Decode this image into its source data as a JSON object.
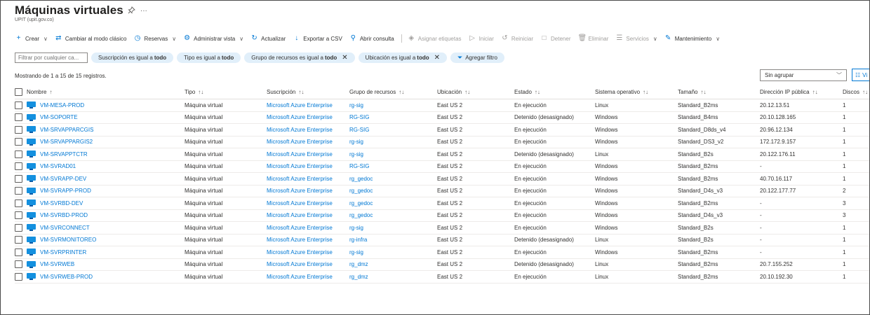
{
  "header": {
    "title": "Máquinas virtuales",
    "subtitle": "UPIT (upit.gov.co)",
    "more": "···"
  },
  "toolbar": {
    "items": [
      {
        "label": "Crear",
        "icon": "plus-icon",
        "glyph": "+",
        "chevron": true,
        "disabled": false
      },
      {
        "label": "Cambiar al modo clásico",
        "icon": "switch-arrows-icon",
        "glyph": "⇄",
        "chevron": false,
        "disabled": false
      },
      {
        "label": "Reservas",
        "icon": "clock-icon",
        "glyph": "◷",
        "chevron": true,
        "disabled": false
      },
      {
        "label": "Administrar vista",
        "icon": "gear-icon",
        "glyph": "⚙",
        "chevron": true,
        "disabled": false
      },
      {
        "label": "Actualizar",
        "icon": "refresh-icon",
        "glyph": "↻",
        "chevron": false,
        "disabled": false
      },
      {
        "label": "Exportar a CSV",
        "icon": "download-icon",
        "glyph": "↓",
        "chevron": false,
        "disabled": false
      },
      {
        "label": "Abrir consulta",
        "icon": "query-icon",
        "glyph": "⚲",
        "chevron": false,
        "disabled": false,
        "sep_after": true
      },
      {
        "label": "Asignar etiquetas",
        "icon": "tag-icon",
        "glyph": "◈",
        "chevron": false,
        "disabled": true
      },
      {
        "label": "Iniciar",
        "icon": "play-icon",
        "glyph": "▷",
        "chevron": false,
        "disabled": true
      },
      {
        "label": "Reiniciar",
        "icon": "restart-icon",
        "glyph": "↺",
        "chevron": false,
        "disabled": true
      },
      {
        "label": "Detener",
        "icon": "stop-icon",
        "glyph": "□",
        "chevron": false,
        "disabled": true
      },
      {
        "label": "Eliminar",
        "icon": "trash-icon",
        "glyph": "🗑",
        "chevron": false,
        "disabled": true
      },
      {
        "label": "Servicios",
        "icon": "list-icon",
        "glyph": "☰",
        "chevron": true,
        "disabled": true
      },
      {
        "label": "Mantenimiento",
        "icon": "wrench-icon",
        "glyph": "✎",
        "chevron": true,
        "disabled": false
      }
    ]
  },
  "filters": {
    "search_placeholder": "Filtrar por cualquier ca...",
    "pills": [
      {
        "text": "Suscripción es igual a",
        "value": "todo",
        "removable": false
      },
      {
        "text": "Tipo es igual a",
        "value": "todo",
        "removable": false
      },
      {
        "text": "Grupo de recursos es igual a",
        "value": "todo",
        "removable": true
      },
      {
        "text": "Ubicación es igual a",
        "value": "todo",
        "removable": true
      }
    ],
    "add_filter": "Agregar filtro"
  },
  "status": {
    "records": "Mostrando de 1 a 15 de 15 registros.",
    "grouping": "Sin agrupar",
    "view_button": "Vi"
  },
  "table": {
    "columns": [
      {
        "key": "name",
        "label": "Nombre",
        "sort": "↑"
      },
      {
        "key": "tipo",
        "label": "Tipo",
        "sort": "↑↓"
      },
      {
        "key": "sub",
        "label": "Suscripción",
        "sort": "↑↓"
      },
      {
        "key": "grp",
        "label": "Grupo de recursos",
        "sort": "↑↓"
      },
      {
        "key": "ubi",
        "label": "Ubicación",
        "sort": "↑↓"
      },
      {
        "key": "est",
        "label": "Estado",
        "sort": "↑↓"
      },
      {
        "key": "so",
        "label": "Sistema operativo",
        "sort": "↑↓"
      },
      {
        "key": "tam",
        "label": "Tamaño",
        "sort": "↑↓"
      },
      {
        "key": "ip",
        "label": "Dirección IP pública",
        "sort": "↑↓"
      },
      {
        "key": "disc",
        "label": "Discos",
        "sort": "↑↓"
      }
    ],
    "rows": [
      {
        "name": "VM-MESA-PROD",
        "tipo": "Máquina virtual",
        "sub": "Microsoft Azure Enterprise",
        "grp": "rg-sig",
        "ubi": "East US 2",
        "est": "En ejecución",
        "so": "Linux",
        "tam": "Standard_B2ms",
        "ip": "20.12.13.51",
        "disc": "1"
      },
      {
        "name": "VM-SOPORTE",
        "tipo": "Máquina virtual",
        "sub": "Microsoft Azure Enterprise",
        "grp": "RG-SIG",
        "ubi": "East US 2",
        "est": "Detenido (desasignado)",
        "so": "Windows",
        "tam": "Standard_B4ms",
        "ip": "20.10.128.165",
        "disc": "1"
      },
      {
        "name": "VM-SRVAPPARCGIS",
        "tipo": "Máquina virtual",
        "sub": "Microsoft Azure Enterprise",
        "grp": "RG-SIG",
        "ubi": "East US 2",
        "est": "En ejecución",
        "so": "Windows",
        "tam": "Standard_D8ds_v4",
        "ip": "20.96.12.134",
        "disc": "1"
      },
      {
        "name": "VM-SRVAPPARGIS2",
        "tipo": "Máquina virtual",
        "sub": "Microsoft Azure Enterprise",
        "grp": "rg-sig",
        "ubi": "East US 2",
        "est": "En ejecución",
        "so": "Windows",
        "tam": "Standard_DS3_v2",
        "ip": "172.172.9.157",
        "disc": "1"
      },
      {
        "name": "VM-SRVAPPTCTR",
        "tipo": "Máquina virtual",
        "sub": "Microsoft Azure Enterprise",
        "grp": "rg-sig",
        "ubi": "East US 2",
        "est": "Detenido (desasignado)",
        "so": "Linux",
        "tam": "Standard_B2s",
        "ip": "20.122.176.11",
        "disc": "1"
      },
      {
        "name": "VM-SVRAD01",
        "tipo": "Máquina virtual",
        "sub": "Microsoft Azure Enterprise",
        "grp": "RG-SIG",
        "ubi": "East US 2",
        "est": "En ejecución",
        "so": "Windows",
        "tam": "Standard_B2ms",
        "ip": "-",
        "disc": "1"
      },
      {
        "name": "VM-SVRAPP-DEV",
        "tipo": "Máquina virtual",
        "sub": "Microsoft Azure Enterprise",
        "grp": "rg_gedoc",
        "ubi": "East US 2",
        "est": "En ejecución",
        "so": "Windows",
        "tam": "Standard_B2ms",
        "ip": "40.70.16.117",
        "disc": "1"
      },
      {
        "name": "VM-SVRAPP-PROD",
        "tipo": "Máquina virtual",
        "sub": "Microsoft Azure Enterprise",
        "grp": "rg_gedoc",
        "ubi": "East US 2",
        "est": "En ejecución",
        "so": "Windows",
        "tam": "Standard_D4s_v3",
        "ip": "20.122.177.77",
        "disc": "2"
      },
      {
        "name": "VM-SVRBD-DEV",
        "tipo": "Máquina virtual",
        "sub": "Microsoft Azure Enterprise",
        "grp": "rg_gedoc",
        "ubi": "East US 2",
        "est": "En ejecución",
        "so": "Windows",
        "tam": "Standard_B2ms",
        "ip": "-",
        "disc": "3"
      },
      {
        "name": "VM-SVRBD-PROD",
        "tipo": "Máquina virtual",
        "sub": "Microsoft Azure Enterprise",
        "grp": "rg_gedoc",
        "ubi": "East US 2",
        "est": "En ejecución",
        "so": "Windows",
        "tam": "Standard_D4s_v3",
        "ip": "-",
        "disc": "3"
      },
      {
        "name": "VM-SVRCONNECT",
        "tipo": "Máquina virtual",
        "sub": "Microsoft Azure Enterprise",
        "grp": "rg-sig",
        "ubi": "East US 2",
        "est": "En ejecución",
        "so": "Windows",
        "tam": "Standard_B2s",
        "ip": "-",
        "disc": "1"
      },
      {
        "name": "VM-SVRMONITOREO",
        "tipo": "Máquina virtual",
        "sub": "Microsoft Azure Enterprise",
        "grp": "rg-infra",
        "ubi": "East US 2",
        "est": "Detenido (desasignado)",
        "so": "Linux",
        "tam": "Standard_B2s",
        "ip": "-",
        "disc": "1"
      },
      {
        "name": "VM-SVRPRINTER",
        "tipo": "Máquina virtual",
        "sub": "Microsoft Azure Enterprise",
        "grp": "rg-sig",
        "ubi": "East US 2",
        "est": "En ejecución",
        "so": "Windows",
        "tam": "Standard_B2ms",
        "ip": "-",
        "disc": "1"
      },
      {
        "name": "VM-SVRWEB",
        "tipo": "Máquina virtual",
        "sub": "Microsoft Azure Enterprise",
        "grp": "rg_dmz",
        "ubi": "East US 2",
        "est": "Detenido (desasignado)",
        "so": "Linux",
        "tam": "Standard_B2ms",
        "ip": "20.7.155.252",
        "disc": "1"
      },
      {
        "name": "VM-SVRWEB-PROD",
        "tipo": "Máquina virtual",
        "sub": "Microsoft Azure Enterprise",
        "grp": "rg_dmz",
        "ubi": "East US 2",
        "est": "En ejecución",
        "so": "Linux",
        "tam": "Standard_B2ms",
        "ip": "20.10.192.30",
        "disc": "1"
      }
    ]
  },
  "colors": {
    "accent": "#0078d4",
    "pill_bg": "#e1effa",
    "vm_icon": "#1490df"
  }
}
